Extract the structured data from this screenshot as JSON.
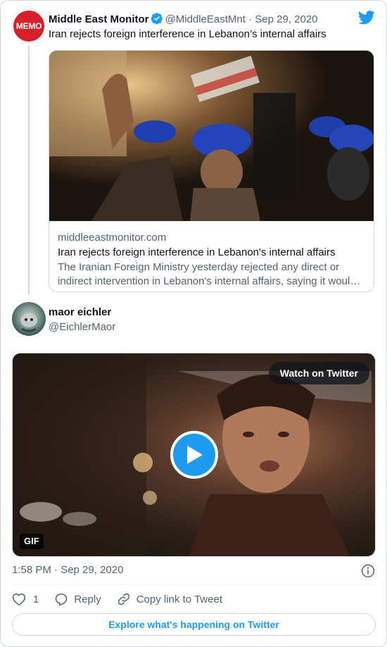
{
  "quoted": {
    "avatar_text": "MEMO",
    "name": "Middle East Monitor",
    "handle": "@MiddleEastMnt",
    "separator": "·",
    "date": "Sep 29, 2020",
    "text": "Iran rejects foreign interference in Lebanon’s internal affairs",
    "link_card": {
      "domain": "middleeastmonitor.com",
      "title": "Iran rejects foreign interference in Lebanon's internal affairs",
      "description": "The Iranian Foreign Ministry yesterday rejected any direct or indirect intervention in Lebanon's internal affairs, saying it woul…"
    }
  },
  "main": {
    "name": "maor eichler",
    "handle": "@EichlerMaor",
    "media": {
      "watch_label": "Watch on Twitter",
      "badge": "GIF"
    },
    "timestamp": "1:58 PM · Sep 29, 2020"
  },
  "actions": {
    "like_count": "1",
    "reply_label": "Reply",
    "copy_label": "Copy link to Tweet"
  },
  "explore_label": "Explore what's happening on Twitter",
  "colors": {
    "accent": "#1d9bf0",
    "memo_red": "#d81e2a",
    "muted": "#536471"
  }
}
